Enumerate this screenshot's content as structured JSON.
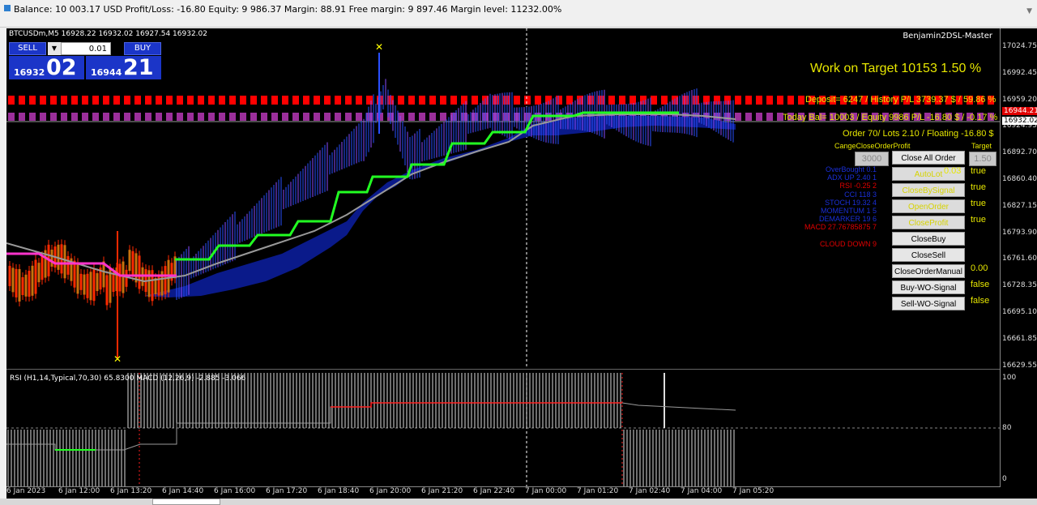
{
  "status_bar": {
    "text": "Balance: 10 003.17 USD  Profit/Loss: -16.80  Equity: 9 986.37  Margin: 88.91  Free margin: 9 897.46  Margin level: 11232.00%"
  },
  "chart": {
    "symbol_line": "BTCUSDm,M5  16928.22 16932.02 16927.54 16932.02",
    "ea_name": "Benjamin2DSL-Master",
    "price_labels": [
      "17024.75",
      "16992.45",
      "16959.20",
      "16924.95",
      "16892.70",
      "16860.40",
      "16827.15",
      "16793.90",
      "16761.60",
      "16728.35",
      "16695.10",
      "16661.85",
      "16629.55"
    ],
    "current_price_red": "16944.21",
    "current_price": "16932.02",
    "time_labels": [
      "6 Jan 2023",
      "6 Jan 12:00",
      "6 Jan 13:20",
      "6 Jan 14:40",
      "6 Jan 16:00",
      "6 Jan 17:20",
      "6 Jan 18:40",
      "6 Jan 20:00",
      "6 Jan 21:20",
      "6 Jan 22:40",
      "7 Jan 00:00",
      "7 Jan 01:20",
      "7 Jan 02:40",
      "7 Jan 04:00",
      "7 Jan 05:20"
    ],
    "sub_labels": [
      "100",
      "80",
      "0"
    ],
    "indicator_label": "RSI (H1,14,Typical,70,30) 65.8300  MACD (12,26,9) -2.885 -3.066"
  },
  "trade_panel": {
    "sell_label": "SELL",
    "buy_label": "BUY",
    "lot": "0.01",
    "sell_small": "16932",
    "sell_big": "02",
    "buy_small": "16944",
    "buy_big": "21"
  },
  "overlay": {
    "work_target": "Work on Target 10153 1.50 %",
    "deposit": "Deposit= 6247 / History P/L  3739.37 $ / 59.86 %",
    "today": "Today Bal= 10003 / Equity 9986  P/L  -16.80 $ / -0.17 %",
    "order": "Order 70/ Lots  2.10 / Floating -16.80 $",
    "cange_label": "CangeCloseOrderProfit",
    "target_label": "Target",
    "cange_value": "3000",
    "target_value": "1.50",
    "signals": [
      {
        "text": "OverBought 0.1",
        "color": "#1a2fd8"
      },
      {
        "text": "ADX UP 2.40 1",
        "color": "#1a2fd8"
      },
      {
        "text": "RSI -0.25 2",
        "color": "#e00000"
      },
      {
        "text": "CCI 118 3",
        "color": "#1a2fd8"
      },
      {
        "text": "STOCH 19.32 4",
        "color": "#1a2fd8"
      },
      {
        "text": "MOMENTUM 1 5",
        "color": "#1a2fd8"
      },
      {
        "text": "DEMARKER 19 6",
        "color": "#1a2fd8"
      },
      {
        "text": "MACD 27.76785875 7",
        "color": "#e00000"
      },
      {
        "text": "CLOUD DOWN 9",
        "color": "#e00000"
      }
    ],
    "buttons": [
      {
        "label": "Close All Order",
        "value": "",
        "style": "n"
      },
      {
        "label": "AutoLot",
        "value": "0.03",
        "style": "y",
        "value2": "true"
      },
      {
        "label": "CloseBySignal",
        "value": "true",
        "style": "y"
      },
      {
        "label": "OpenOrder",
        "value": "true",
        "style": "y"
      },
      {
        "label": "CloseProfit",
        "value": "true",
        "style": "y"
      },
      {
        "label": "CloseBuy",
        "value": "",
        "style": "n"
      },
      {
        "label": "CloseSell",
        "value": "",
        "style": "n"
      },
      {
        "label": "CloseOrderManual",
        "value": "0.00",
        "style": "n"
      },
      {
        "label": "Buy-WO-Signal",
        "value": "false",
        "style": "n"
      },
      {
        "label": "Sell-WO-Signal",
        "value": "false",
        "style": "n"
      }
    ]
  },
  "colors": {
    "bull": "#2950ff",
    "bear": "#ff2a00",
    "cloud": "#0a1a8a",
    "trend_green": "#22ff22",
    "ma_gray": "#999999",
    "magenta": "#ff33cc"
  }
}
